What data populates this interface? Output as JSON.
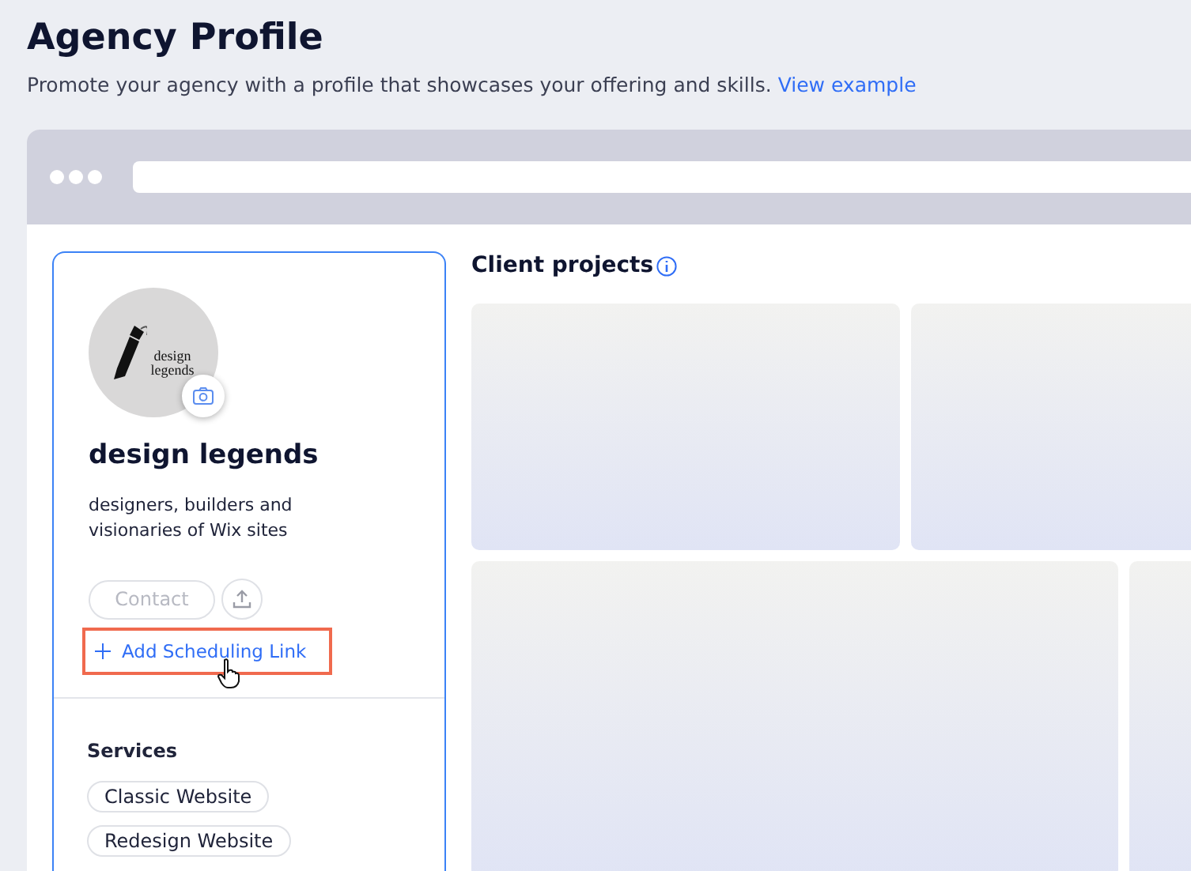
{
  "header": {
    "title": "Agency Profile",
    "subtitle": "Promote your agency with a profile that showcases your offering and skills.",
    "link": "View example"
  },
  "profile": {
    "logo_text": [
      "design",
      "legends"
    ],
    "name": "design legends",
    "description": "designers, builders and visionaries of Wix sites",
    "contact_button": {
      "label": "Contact",
      "disabled": true
    },
    "scheduling_link": {
      "label": "Add Scheduling Link",
      "highlighted": true
    },
    "services_title": "Services",
    "services": [
      "Classic Website",
      "Redesign Website"
    ]
  },
  "projects": {
    "title": "Client projects"
  }
}
